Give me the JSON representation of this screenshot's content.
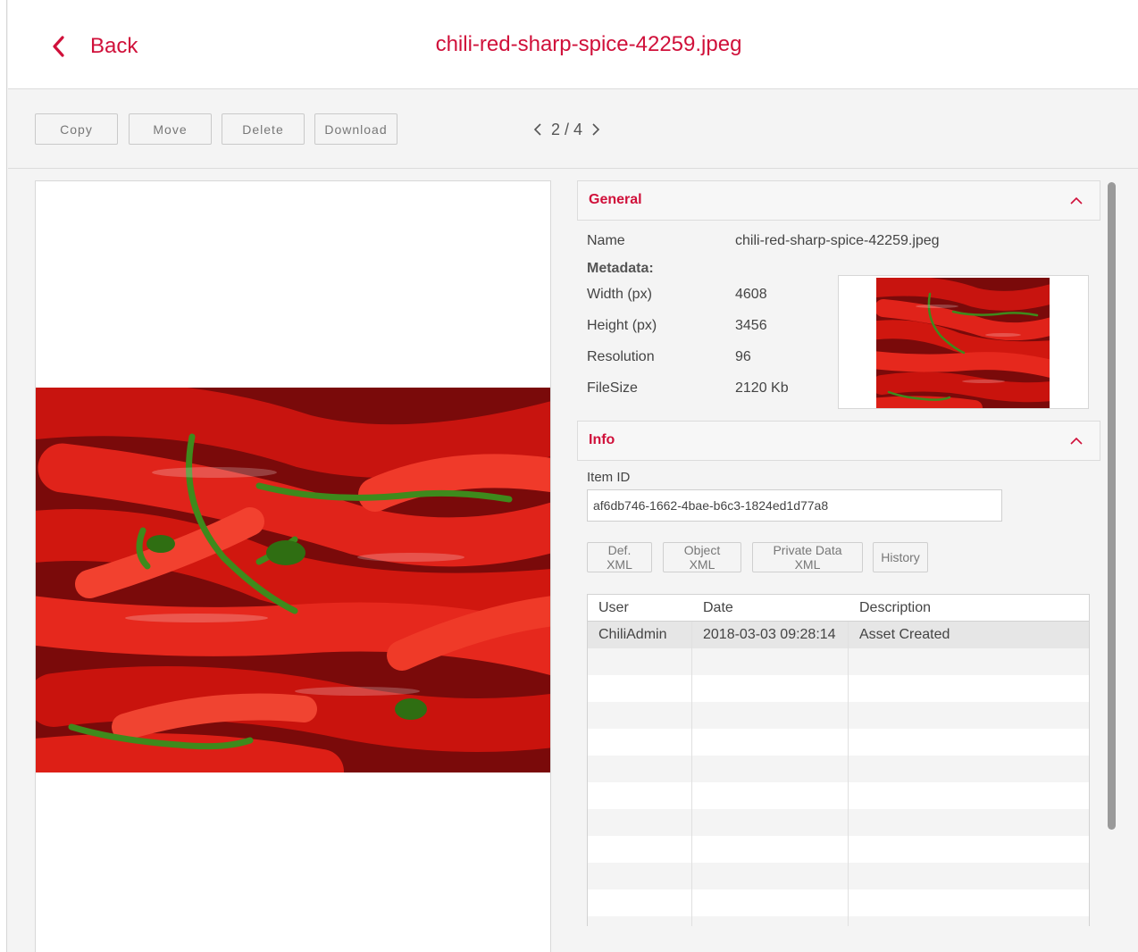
{
  "header": {
    "back_label": "Back",
    "file_title": "chili-red-sharp-spice-42259.jpeg"
  },
  "toolbar": {
    "copy_label": "Copy",
    "move_label": "Move",
    "delete_label": "Delete",
    "download_label": "Download",
    "pager_text": "2 / 4"
  },
  "general": {
    "title": "General",
    "name_label": "Name",
    "name_value": "chili-red-sharp-spice-42259.jpeg",
    "metadata_label": "Metadata:",
    "props": [
      {
        "label": "Width (px)",
        "value": "4608"
      },
      {
        "label": "Height (px)",
        "value": "3456"
      },
      {
        "label": "Resolution",
        "value": "96"
      },
      {
        "label": "FileSize",
        "value": "2120 Kb"
      }
    ]
  },
  "info": {
    "title": "Info",
    "item_id_label": "Item ID",
    "item_id_value": "af6db746-1662-4bae-b6c3-1824ed1d77a8",
    "buttons": [
      "Def. XML",
      "Object XML",
      "Private Data XML",
      "History"
    ],
    "table": {
      "headers": [
        "User",
        "Date",
        "Description"
      ],
      "rows": [
        [
          "ChiliAdmin",
          "2018-03-03 09:28:14",
          "Asset Created"
        ]
      ]
    }
  },
  "colors": {
    "accent": "#d0103a",
    "background": "#f4f4f4"
  }
}
